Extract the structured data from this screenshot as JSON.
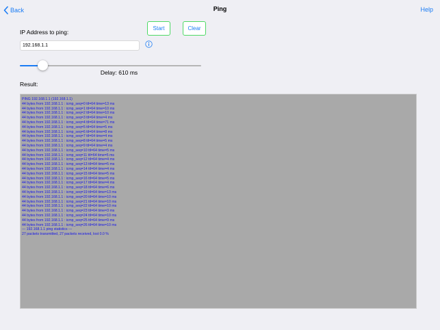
{
  "nav": {
    "back_label": "Back",
    "title": "Ping",
    "help_label": "Help"
  },
  "ip": {
    "label": "IP Address to ping:",
    "value": "192.168.1.1"
  },
  "buttons": {
    "start_label": "Start",
    "clear_label": "Clear"
  },
  "delay": {
    "slider_fraction": 0.126,
    "label": "Delay: 610 ms"
  },
  "result": {
    "label": "Result:",
    "lines": [
      "PING 192.168.1.1 (192.168.1.1)",
      "44 bytes from 192.168.1.1 : icmp_seq=0 ttl=64 time=13 ms",
      "44 bytes from 192.168.1.1 : icmp_seq=1 ttl=64 time=10 ms",
      "44 bytes from 192.168.1.1 : icmp_seq=2 ttl=64 time=10 ms",
      "44 bytes from 192.168.1.1 : icmp_seq=3 ttl=64 time=4 ms",
      "44 bytes from 192.168.1.1 : icmp_seq=4 ttl=64 time=71 ms",
      "44 bytes from 192.168.1.1 : icmp_seq=5 ttl=64 time=5 ms",
      "44 bytes from 192.168.1.1 : icmp_seq=6 ttl=64 time=8 ms",
      "44 bytes from 192.168.1.1 : icmp_seq=7 ttl=64 time=4 ms",
      "44 bytes from 192.168.1.1 : icmp_seq=8 ttl=64 time=5 ms",
      "44 bytes from 192.168.1.1 : icmp_seq=9 ttl=64 time=4 ms",
      "44 bytes from 192.168.1.1 : icmp_seq=10 ttl=64 time=5 ms",
      "44 bytes from 192.168.1.1 : icmp_seq=11 ttl=64 time=5 ms",
      "44 bytes from 192.168.1.1 : icmp_seq=12 ttl=64 time=4 ms",
      "44 bytes from 192.168.1.1 : icmp_seq=13 ttl=64 time=5 ms",
      "44 bytes from 192.168.1.1 : icmp_seq=14 ttl=64 time=4 ms",
      "44 bytes from 192.168.1.1 : icmp_seq=15 ttl=64 time=5 ms",
      "44 bytes from 192.168.1.1 : icmp_seq=16 ttl=64 time=5 ms",
      "44 bytes from 192.168.1.1 : icmp_seq=17 ttl=64 time=4 ms",
      "44 bytes from 192.168.1.1 : icmp_seq=18 ttl=64 time=6 ms",
      "44 bytes from 192.168.1.1 : icmp_seq=19 ttl=64 time=13 ms",
      "44 bytes from 192.168.1.1 : icmp_seq=20 ttl=64 time=10 ms",
      "44 bytes from 192.168.1.1 : icmp_seq=21 ttl=64 time=10 ms",
      "44 bytes from 192.168.1.1 : icmp_seq=22 ttl=64 time=10 ms",
      "44 bytes from 192.168.1.1 : icmp_seq=23 ttl=64 time=3 ms",
      "44 bytes from 192.168.1.1 : icmp_seq=24 ttl=64 time=10 ms",
      "44 bytes from 192.168.1.1 : icmp_seq=25 ttl=64 time=9 ms",
      "44 bytes from 192.168.1.1 : icmp_seq=26 ttl=64 time=10 ms",
      "--- 192.168.1.1 ping statistics ---",
      "27 packets transmitted, 27 packets received, lost 0.0 %"
    ]
  },
  "icons": {
    "back": "chevron-left-icon",
    "info": "info-icon"
  },
  "colors": {
    "accent": "#1a7cf5",
    "button_border": "#4cd964",
    "output_bg": "#a9a9a9",
    "output_text": "#1515e8",
    "page_bg": "#efeff4"
  }
}
